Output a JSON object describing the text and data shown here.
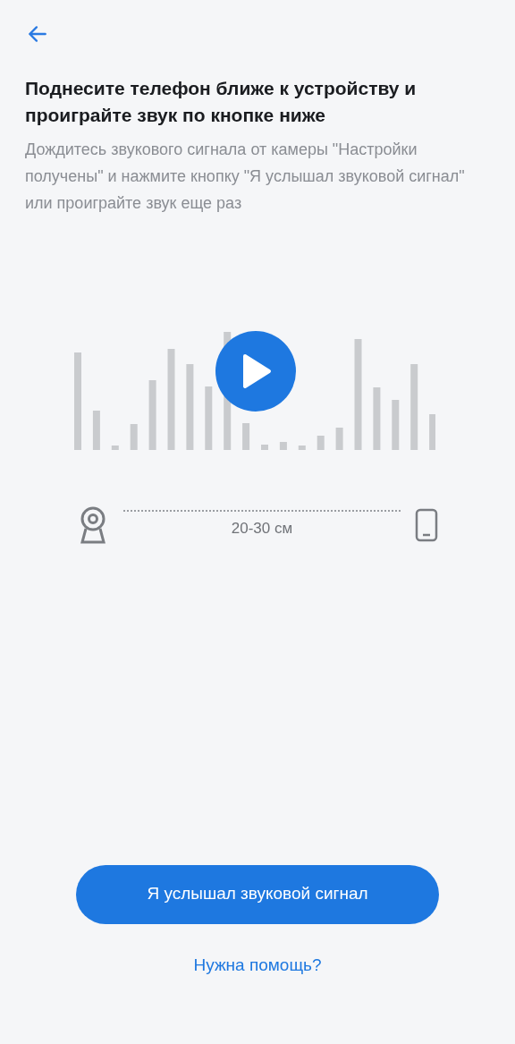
{
  "title": "Поднесите телефон ближе к устройству и проиграйте звук по кнопке ниже",
  "description": "Дождитесь звукового сигнала от камеры \"Настройки получены\" и нажмите кнопку \"Я услышал звуковой сигнал\" или проиграйте звук еще раз",
  "distance": "20-30 см",
  "primary_button": "Я услышал звуковой сигнал",
  "help_link": "Нужна помощь?"
}
